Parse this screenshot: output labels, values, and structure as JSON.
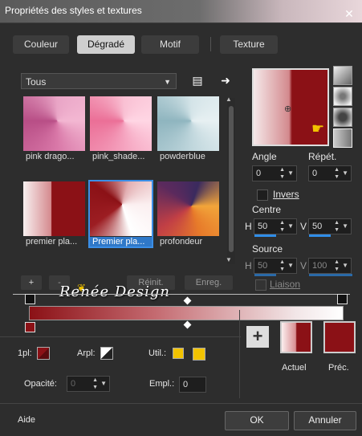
{
  "window": {
    "title": "Propriétés des styles et textures",
    "help_icon": "question-icon",
    "close_icon": "close-icon"
  },
  "tabs": [
    {
      "label": "Couleur",
      "active": false
    },
    {
      "label": "Dégradé",
      "active": true
    },
    {
      "label": "Motif",
      "active": false
    },
    {
      "label": "Texture",
      "active": false
    }
  ],
  "category": {
    "value": "Tous"
  },
  "gradients": [
    {
      "name": "pink drago...",
      "selected": false
    },
    {
      "name": "pink_shade...",
      "selected": false
    },
    {
      "name": "powderblue",
      "selected": false
    },
    {
      "name": "premier pla...",
      "selected": false
    },
    {
      "name": "Premier pla...",
      "selected": true
    },
    {
      "name": "profondeur",
      "selected": false
    }
  ],
  "grid_buttons": {
    "add": "+",
    "remove": "-",
    "reset": "Réinit.",
    "save": "Enreg."
  },
  "angle": {
    "label": "Angle",
    "value": "0"
  },
  "repeat": {
    "label": "Répét.",
    "value": "0"
  },
  "invert": {
    "label": "Invers",
    "checked": false
  },
  "center": {
    "label": "Centre",
    "h_label": "H",
    "h_value": "50",
    "v_label": "V",
    "v_value": "50"
  },
  "source": {
    "label": "Source",
    "h_label": "H",
    "h_value": "50",
    "v_label": "V",
    "v_value": "100"
  },
  "link": {
    "label": "Liaison",
    "checked": false
  },
  "watermark": "Renée Design",
  "stops": {
    "color_label": "1pl:",
    "arpl_label": "Arpl:",
    "util_label": "Util.:",
    "opacity_label": "Opacité:",
    "opacity_value": "0",
    "empl_label": "Empl.:",
    "empl_value": "0"
  },
  "current_label": "Actuel",
  "previous_label": "Préc.",
  "footer": {
    "help": "Aide",
    "ok": "OK",
    "cancel": "Annuler"
  },
  "colors": {
    "dark_red": "#8b1116",
    "accent_blue": "#2f78c8",
    "gold": "#f2c300"
  }
}
